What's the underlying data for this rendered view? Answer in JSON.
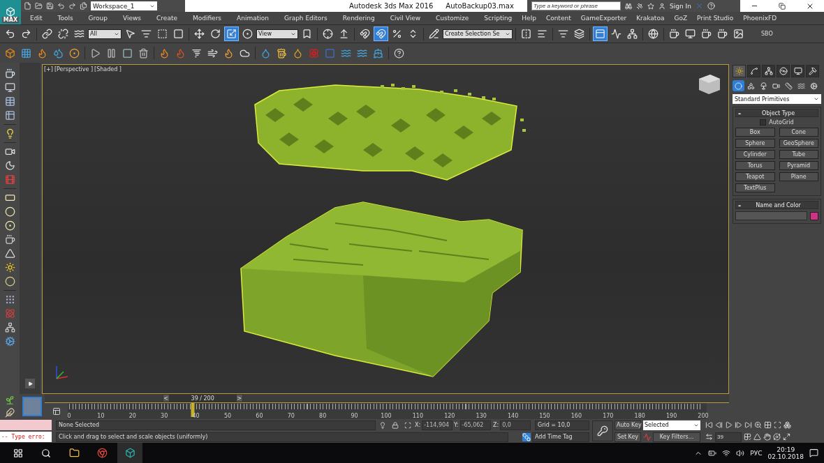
{
  "title_bar": {
    "logo": "MAX",
    "workspace": "Workspace_1",
    "app_title": "Autodesk 3ds Max 2016",
    "file_name": "AutoBackup03.max",
    "search": {
      "placeholder": "Type a keyword or phrase"
    },
    "sign_in": "Sign In"
  },
  "menu_bar": {
    "items": [
      "Edit",
      "Tools",
      "Group",
      "Views",
      "Create",
      "Modifiers",
      "Animation",
      "Graph Editors",
      "Rendering",
      "Civil View",
      "Customize",
      "Scripting",
      "Help",
      "Content",
      "GameExporter",
      "Krakatoa",
      "GoZ",
      "Print Studio",
      "PhoenixFD"
    ]
  },
  "main_toolbar": {
    "items": [
      {
        "kind": "undo",
        "on": false
      },
      {
        "kind": "redo",
        "on": false
      },
      {
        "kind": "sep"
      },
      {
        "kind": "link",
        "on": false
      },
      {
        "kind": "unlink",
        "on": false
      },
      {
        "kind": "waves",
        "on": false
      },
      {
        "kind": "dropdown",
        "value": "All"
      },
      {
        "kind": "select",
        "on": false
      },
      {
        "kind": "list",
        "on": false
      },
      {
        "kind": "rect",
        "on": false
      },
      {
        "kind": "window",
        "on": false
      },
      {
        "kind": "sep"
      },
      {
        "kind": "move",
        "on": false
      },
      {
        "kind": "rotate",
        "on": false
      },
      {
        "kind": "scale",
        "on": true
      },
      {
        "kind": "sphere",
        "on": false
      },
      {
        "kind": "dropdown",
        "value": "View"
      },
      {
        "kind": "bookmark",
        "on": false
      },
      {
        "kind": "sep"
      },
      {
        "kind": "pivot",
        "on": false
      },
      {
        "kind": "upload",
        "on": false
      },
      {
        "kind": "sep"
      },
      {
        "kind": "magnet",
        "on": false
      },
      {
        "kind": "angle",
        "on": true
      },
      {
        "kind": "percent",
        "on": false
      },
      {
        "kind": "spinner",
        "on": false
      },
      {
        "kind": "sep"
      },
      {
        "kind": "pencil",
        "on": false
      },
      {
        "kind": "dropdown",
        "value": "Create Selection Se"
      },
      {
        "kind": "sep"
      },
      {
        "kind": "mirror",
        "on": false
      },
      {
        "kind": "align",
        "on": false
      },
      {
        "kind": "sep"
      },
      {
        "kind": "list",
        "on": false
      },
      {
        "kind": "layers",
        "on": false
      },
      {
        "kind": "sep"
      },
      {
        "kind": "ribbon",
        "on": true
      },
      {
        "kind": "curve",
        "on": false
      },
      {
        "kind": "schematic",
        "on": false
      },
      {
        "kind": "sep"
      },
      {
        "kind": "globe",
        "on": false
      },
      {
        "kind": "sep"
      },
      {
        "kind": "cup",
        "on": false
      },
      {
        "kind": "frame",
        "on": false
      },
      {
        "kind": "cup",
        "on": false
      },
      {
        "kind": "cup",
        "on": false
      },
      {
        "kind": "image",
        "on": false
      },
      {
        "kind": "text",
        "value": "SBO"
      }
    ]
  },
  "viewport": {
    "labels": [
      "[+]",
      "[Perspective ]",
      "[Shaded ]"
    ]
  },
  "command_panel": {
    "tabs": [
      {
        "kind": "create",
        "selected": true
      },
      {
        "kind": "modify",
        "selected": false
      },
      {
        "kind": "hierarchy",
        "selected": false
      },
      {
        "kind": "motion",
        "selected": false
      },
      {
        "kind": "display",
        "selected": false
      },
      {
        "kind": "utilities",
        "selected": false
      }
    ],
    "categories": [
      {
        "kind": "geometry",
        "selected": true
      },
      {
        "kind": "shapes",
        "selected": false
      },
      {
        "kind": "lights",
        "selected": false
      },
      {
        "kind": "cameras",
        "selected": false
      },
      {
        "kind": "helpers",
        "selected": false
      },
      {
        "kind": "warps",
        "selected": false
      },
      {
        "kind": "systems",
        "selected": false
      }
    ],
    "subcategory": "Standard Primitives",
    "object_type": {
      "collapse": "-",
      "title": "Object Type",
      "autogrid": {
        "label": "AutoGrid",
        "checked": false
      },
      "buttons": [
        "Box",
        "Cone",
        "Sphere",
        "GeoSphere",
        "Cylinder",
        "Tube",
        "Torus",
        "Pyramid",
        "Teapot",
        "Plane",
        "TextPlus"
      ]
    },
    "name_and_color": {
      "collapse": "-",
      "title": "Name and Color"
    }
  },
  "timeline": {
    "prev": "<",
    "frame_label": "39 / 200",
    "next": ">",
    "level": 0.195,
    "ticks": [
      "0",
      "10",
      "20",
      "30",
      "40",
      "50",
      "60",
      "70",
      "80",
      "90",
      "100",
      "110",
      "120",
      "130",
      "140",
      "150",
      "160",
      "170",
      "180",
      "190",
      "200"
    ]
  },
  "status": {
    "script_error": "-- Type erro:",
    "selection": "None Selected",
    "prompt": "Click and drag to select and scale objects (uniformly)",
    "coords": [
      {
        "axis": "X:",
        "value": "-114,904"
      },
      {
        "axis": "Y:",
        "value": "-65,062"
      },
      {
        "axis": "Z:",
        "value": "0,0"
      }
    ],
    "grid": "Grid = 10,0",
    "add_time_tag": "Add Time Tag",
    "auto_key": "Auto Key",
    "key_mode": "Selected",
    "set_key": "Set Key",
    "key_filters": "Key Filters...",
    "current_frame": "39"
  },
  "taskbar": {
    "language": "РУС",
    "time": "20:19",
    "date": "02.10.2018"
  }
}
